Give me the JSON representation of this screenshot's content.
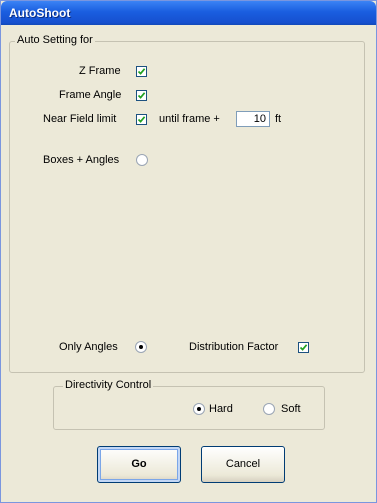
{
  "window": {
    "title": "AutoShoot"
  },
  "auto_setting": {
    "legend": "Auto Setting for",
    "z_frame": {
      "label": "Z Frame",
      "checked": true
    },
    "frame_angle": {
      "label": "Frame Angle",
      "checked": true
    },
    "near_field_limit": {
      "label": "Near Field limit",
      "checked": true
    },
    "until_frame": {
      "label": "until frame +",
      "value": "10",
      "unit": "ft"
    },
    "boxes_angles": {
      "label": "Boxes + Angles",
      "selected": false
    },
    "only_angles": {
      "label": "Only Angles",
      "selected": true
    },
    "distribution_factor": {
      "label": "Distribution Factor",
      "checked": true
    }
  },
  "directivity": {
    "legend": "Directivity Control",
    "hard": {
      "label": "Hard",
      "selected": true
    },
    "soft": {
      "label": "Soft",
      "selected": false
    }
  },
  "buttons": {
    "go": "Go",
    "cancel": "Cancel"
  }
}
